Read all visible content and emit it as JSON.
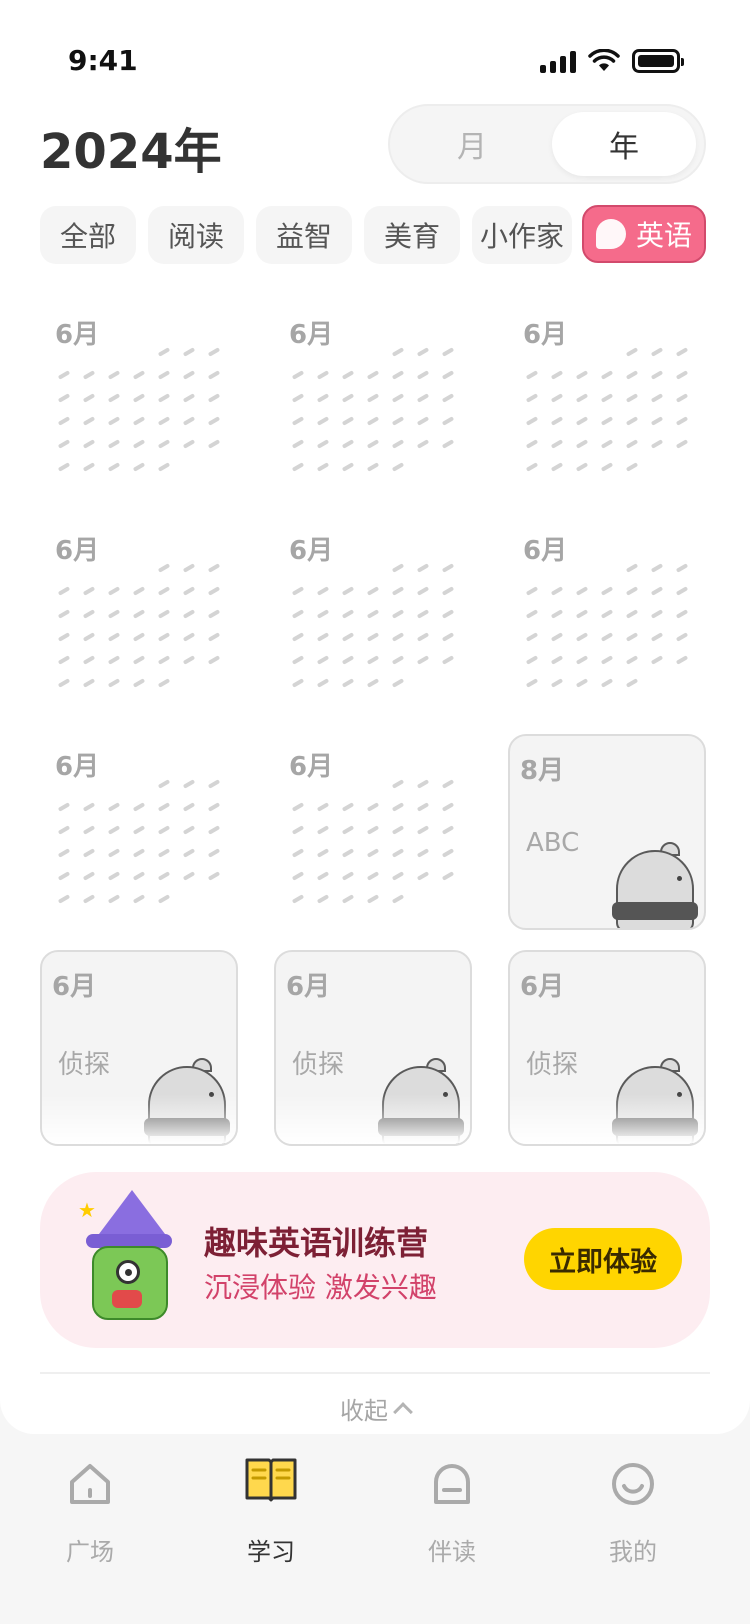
{
  "status_bar": {
    "time": "9:41"
  },
  "header": {
    "title": "2024年",
    "toggle": {
      "month": "月",
      "year": "年",
      "selected": "year"
    }
  },
  "filters": [
    {
      "label": "全部",
      "active": false
    },
    {
      "label": "阅读",
      "active": false
    },
    {
      "label": "益智",
      "active": false
    },
    {
      "label": "美育",
      "active": false
    },
    {
      "label": "小作家",
      "active": false
    },
    {
      "label": "英语",
      "active": true
    }
  ],
  "grid": {
    "rows": [
      [
        {
          "month": "6月",
          "type": "dots"
        },
        {
          "month": "6月",
          "type": "dots"
        },
        {
          "month": "6月",
          "type": "dots"
        }
      ],
      [
        {
          "month": "6月",
          "type": "dots"
        },
        {
          "month": "6月",
          "type": "dots"
        },
        {
          "month": "6月",
          "type": "dots"
        }
      ],
      [
        {
          "month": "6月",
          "type": "dots"
        },
        {
          "month": "6月",
          "type": "dots"
        },
        {
          "month": "8月",
          "type": "badge",
          "text": "ABC"
        }
      ],
      [
        {
          "month": "6月",
          "type": "badge",
          "text": "侦探"
        },
        {
          "month": "6月",
          "type": "badge",
          "text": "侦探"
        },
        {
          "month": "6月",
          "type": "badge",
          "text": "侦探"
        }
      ]
    ]
  },
  "promo": {
    "title": "趣味英语训练营",
    "subtitle": "沉浸体验 激发兴趣",
    "button": "立即体验"
  },
  "collapse_label": "收起",
  "tabs": [
    {
      "label": "广场",
      "icon": "home-icon",
      "active": false
    },
    {
      "label": "学习",
      "icon": "book-icon",
      "active": true
    },
    {
      "label": "伴读",
      "icon": "robot-icon",
      "active": false
    },
    {
      "label": "我的",
      "icon": "smile-icon",
      "active": false
    }
  ],
  "colors": {
    "accent_pink": "#f56b8b",
    "promo_bg": "#fdedf1",
    "promo_button": "#ffd500",
    "active_tab_icon": "#ffd84d"
  }
}
